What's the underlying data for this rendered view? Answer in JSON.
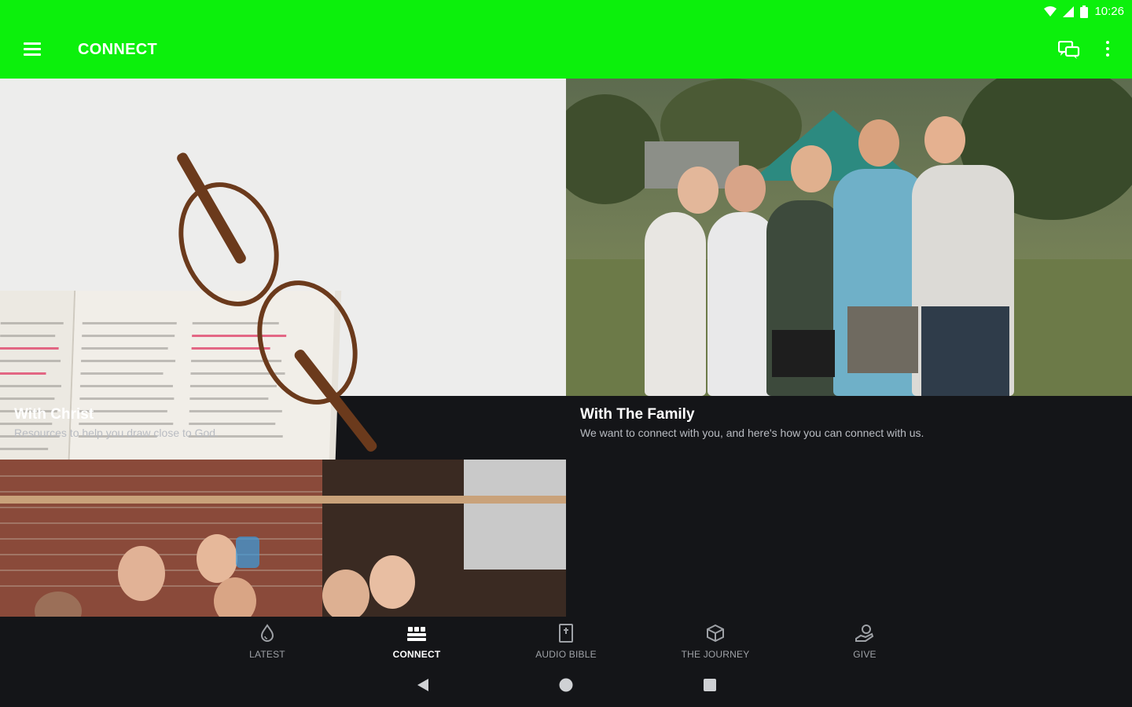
{
  "status": {
    "time": "10:26"
  },
  "appbar": {
    "title": "CONNECT"
  },
  "cards": [
    {
      "title": "With Christ",
      "subtitle": "Resources to help you draw close to God."
    },
    {
      "title": "With The Family",
      "subtitle": "We want to connect with you, and here's how you can connect with us."
    }
  ],
  "bottom_nav": {
    "items": [
      {
        "label": "LATEST",
        "icon": "drop-icon"
      },
      {
        "label": "CONNECT",
        "icon": "group-icon"
      },
      {
        "label": "AUDIO BIBLE",
        "icon": "bible-icon"
      },
      {
        "label": "THE JOURNEY",
        "icon": "box-icon"
      },
      {
        "label": "GIVE",
        "icon": "give-icon"
      }
    ],
    "active": "CONNECT"
  },
  "colors": {
    "accent": "#0cf00c",
    "background": "#141518"
  }
}
